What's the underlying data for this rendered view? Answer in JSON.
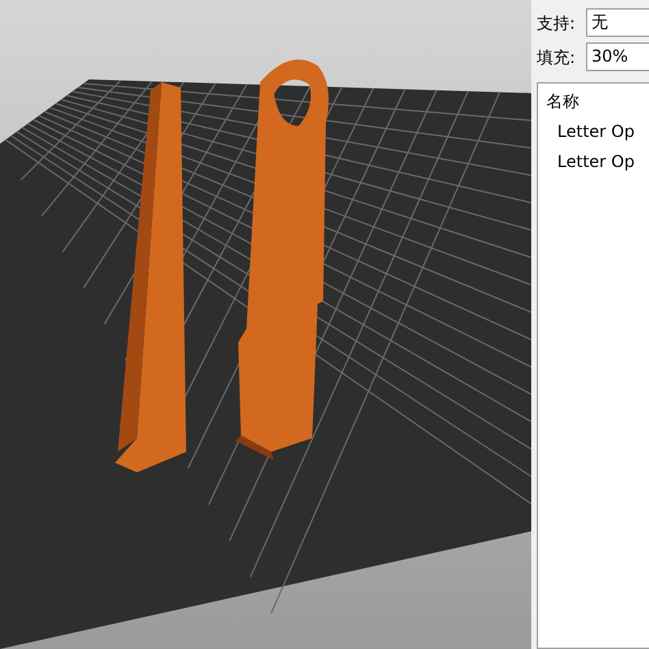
{
  "settings": [
    {
      "label": "支持:",
      "value": "无"
    },
    {
      "label": "填充:",
      "value": "30%"
    }
  ],
  "object_list": {
    "header": "名称",
    "items": [
      {
        "name": "Letter Op"
      },
      {
        "name": "Letter Op"
      }
    ]
  }
}
